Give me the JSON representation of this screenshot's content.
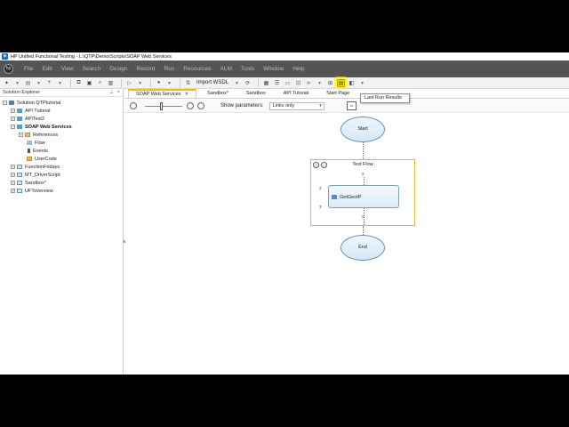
{
  "window": {
    "title": "HP Unified Functional Testing - L:\\QTP\\Demo\\Scripts\\SOAP Web Services"
  },
  "menu": [
    "File",
    "Edit",
    "View",
    "Search",
    "Design",
    "Record",
    "Run",
    "Resources",
    "ALM",
    "Tools",
    "Window",
    "Help"
  ],
  "toolbar": {
    "import_wsdl": "Import WSDL",
    "tooltip": "Last Run Results"
  },
  "sidebar": {
    "title": "Solution Explorer",
    "tree": [
      {
        "label": "Solution QTPtutorial"
      },
      {
        "label": "API Tutorial"
      },
      {
        "label": "APITest2"
      },
      {
        "label": "SOAP Web Services"
      },
      {
        "label": "References"
      },
      {
        "label": "Flow"
      },
      {
        "label": "Events"
      },
      {
        "label": "UserCode"
      },
      {
        "label": "FunctionFridays"
      },
      {
        "label": "MT_DriverScript"
      },
      {
        "label": "Sandbox*"
      },
      {
        "label": "UFToverview"
      }
    ]
  },
  "tabs": [
    {
      "label": "SOAP Web Services"
    },
    {
      "label": "Sandbox*"
    },
    {
      "label": "Sandbox"
    },
    {
      "label": "API Tutorial"
    },
    {
      "label": "Start Page"
    }
  ],
  "canvas_bar": {
    "show_params_label": "Show parameters:",
    "show_params_value": "Links only"
  },
  "flow": {
    "start": "Start",
    "group_title": "Test Flow",
    "action": "GetGeoIP",
    "end": "End",
    "port_in": "2",
    "port_out": "3"
  },
  "colors": {
    "menubar": "#545454",
    "highlight": "#f6e800",
    "tab_accent": "#f2c200",
    "flow_border": "#e0b930"
  }
}
